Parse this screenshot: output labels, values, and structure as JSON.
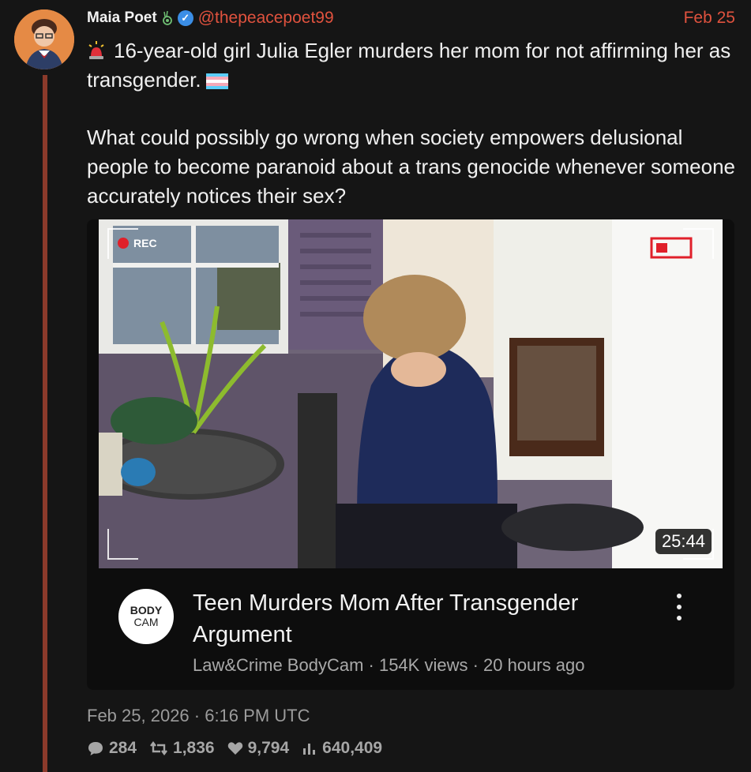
{
  "author": {
    "name": "Maia Poet",
    "handle": "@thepeacepoet99",
    "date_short": "Feb 25"
  },
  "tweet": {
    "line1": "16-year-old girl Julia Egler murders her mom for not affirming her as transgender.",
    "line2": "What could possibly go wrong when society empowers delusional people to become paranoid about a trans genocide whenever someone accurately notices their sex?"
  },
  "video": {
    "rec_label": "REC",
    "duration": "25:44",
    "title": "Teen Murders Mom After Transgender Argument",
    "channel_logo_top": "BODY",
    "channel_logo_bottom": "CAM",
    "meta": "Law&Crime BodyCam · 154K views · 20 hours ago"
  },
  "timestamp": "Feb 25, 2026 · 6:16 PM UTC",
  "stats": {
    "replies": "284",
    "retweets": "1,836",
    "likes": "9,794",
    "views": "640,409"
  },
  "colors": {
    "accent": "#e0523e",
    "thread_line": "#8b3a2b",
    "background": "#151515"
  }
}
